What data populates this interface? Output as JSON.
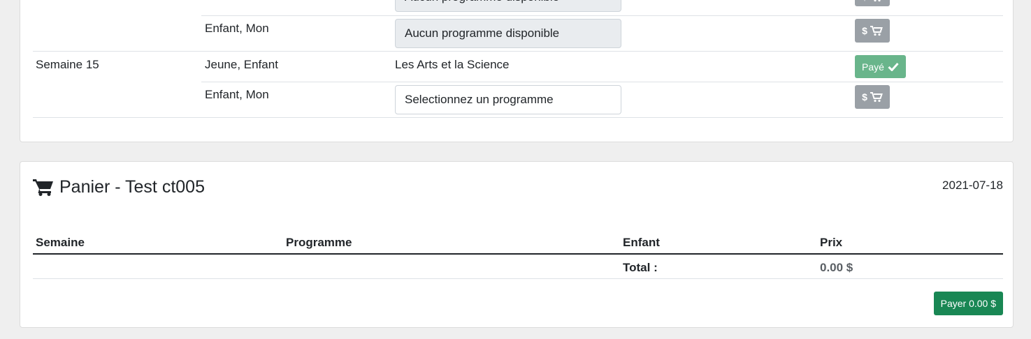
{
  "schedule": {
    "rows": [
      {
        "week": "",
        "children": "",
        "program": "Aucun programme disponible",
        "program_kind": "select-disabled",
        "action": "cart"
      },
      {
        "week": "",
        "children": "Enfant, Mon",
        "program": "Aucun programme disponible",
        "program_kind": "select-disabled",
        "action": "cart"
      },
      {
        "week": "Semaine 15",
        "children": "Jeune, Enfant",
        "program": "Les Arts et la Science",
        "program_kind": "text",
        "action": "paid"
      },
      {
        "week": "",
        "children": "Enfant, Mon",
        "program": "Selectionnez un programme",
        "program_kind": "select",
        "action": "cart"
      }
    ],
    "paid_label": "Payé",
    "cart_button_label": "$"
  },
  "cart": {
    "title": "Panier - Test ct005",
    "date": "2021-07-18",
    "headers": {
      "week": "Semaine",
      "program": "Programme",
      "child": "Enfant",
      "price": "Prix"
    },
    "total_label": "Total :",
    "total_value": "0.00 $",
    "pay_button": "Payer 0.00 $"
  },
  "colors": {
    "paid_button": "#69b58b",
    "cart_button": "#9aa0a6",
    "pay_button": "#198754"
  }
}
